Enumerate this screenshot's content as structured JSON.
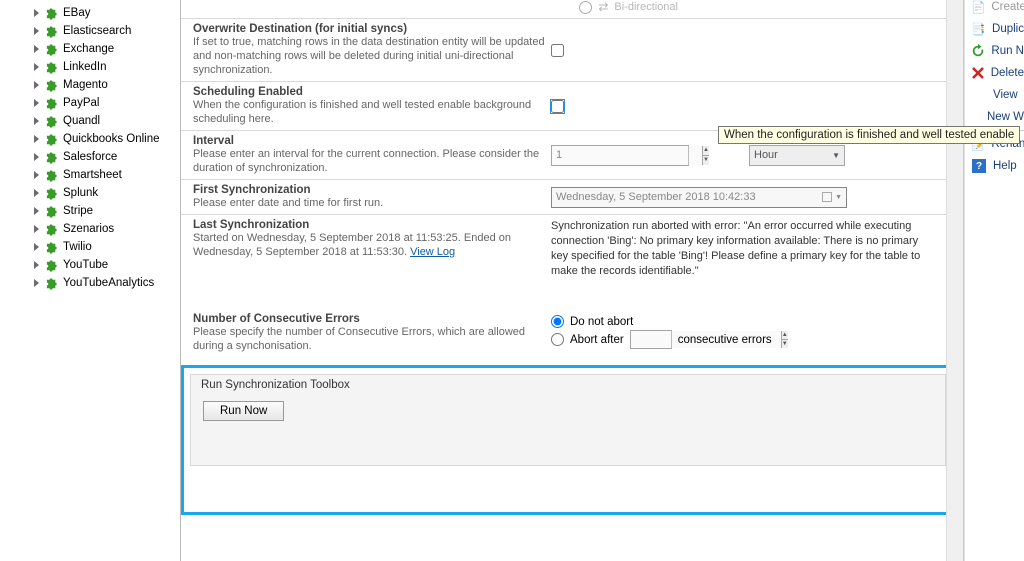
{
  "sidebar": {
    "items": [
      {
        "label": "EBay"
      },
      {
        "label": "Elasticsearch"
      },
      {
        "label": "Exchange"
      },
      {
        "label": "LinkedIn"
      },
      {
        "label": "Magento"
      },
      {
        "label": "PayPal"
      },
      {
        "label": "Quandl"
      },
      {
        "label": "Quickbooks Online"
      },
      {
        "label": "Salesforce"
      },
      {
        "label": "Smartsheet"
      },
      {
        "label": "Splunk"
      },
      {
        "label": "Stripe"
      },
      {
        "label": "Szenarios"
      },
      {
        "label": "Twilio"
      },
      {
        "label": "YouTube"
      },
      {
        "label": "YouTubeAnalytics"
      }
    ]
  },
  "toprow": {
    "label": "Bi-directional"
  },
  "rows": {
    "overwrite": {
      "title": "Overwrite Destination (for initial syncs)",
      "desc": "If set to true, matching rows in the data destination entity will be updated and non-matching rows will be deleted during initial uni-directional synchronization."
    },
    "scheduling": {
      "title": "Scheduling Enabled",
      "desc": "When the configuration is finished and well tested enable background scheduling here."
    },
    "interval": {
      "title": "Interval",
      "desc": "Please enter an interval for the current connection. Please consider the duration of synchronization.",
      "value": "1",
      "unit": "Hour"
    },
    "firstsync": {
      "title": "First Synchronization",
      "desc": "Please enter date and time for first run.",
      "value": "Wednesday,   5 September 2018 10:42:33"
    },
    "lastsync": {
      "title": "Last Synchronization",
      "desc": "Started  on Wednesday, 5 September 2018 at 11:53:25. Ended on Wednesday, 5 September 2018 at 11:53:30. ",
      "link": "View Log",
      "status": "Synchronization run aborted with error: \"An error occurred while executing connection 'Bing': No primary key information available: There is no primary key specified for the table 'Bing'! Please define a primary key for the table to make the records identifiable.\""
    },
    "errors": {
      "title": "Number of Consecutive Errors",
      "desc": "Please specify the number of Consecutive Errors, which are allowed during a synchonisation.",
      "opt_noabort": "Do not abort",
      "opt_abortafter": "Abort after",
      "opt_abortafter_suffix": "consecutive errors",
      "value": ""
    }
  },
  "toolbox": {
    "legend": "Run Synchronization Toolbox",
    "run_label": "Run Now"
  },
  "actions": {
    "create": "Create",
    "duplicate": "Duplic",
    "runnow": "Run N",
    "delete": "Delete",
    "view": "View",
    "neww": "New W",
    "rename": "Renan",
    "help": "Help"
  },
  "tooltip": "When the configuration is finished and well tested enable"
}
